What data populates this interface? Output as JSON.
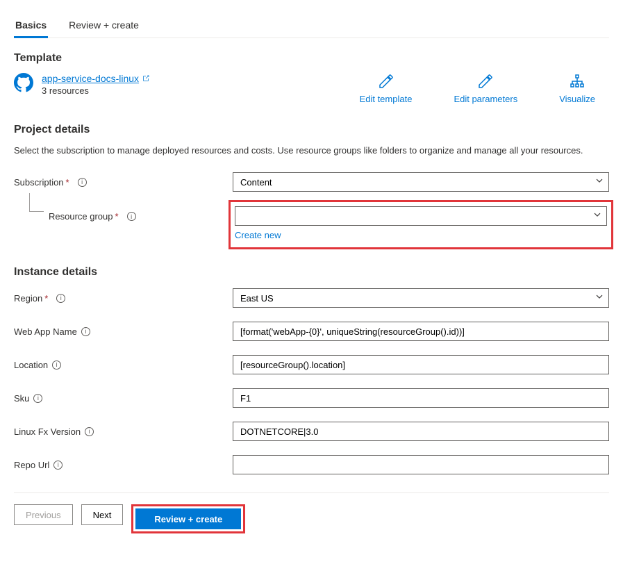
{
  "tabs": {
    "basics": "Basics",
    "review": "Review + create"
  },
  "template": {
    "heading": "Template",
    "name": "app-service-docs-linux",
    "resources": "3 resources",
    "actions": {
      "edit_template": "Edit template",
      "edit_parameters": "Edit parameters",
      "visualize": "Visualize"
    }
  },
  "project": {
    "heading": "Project details",
    "desc": "Select the subscription to manage deployed resources and costs. Use resource groups like folders to organize and manage all your resources.",
    "subscription_label": "Subscription",
    "subscription_value": "Content",
    "resource_group_label": "Resource group",
    "resource_group_value": "",
    "create_new": "Create new"
  },
  "instance": {
    "heading": "Instance details",
    "region_label": "Region",
    "region_value": "East US",
    "webapp_label": "Web App Name",
    "webapp_value": "[format('webApp-{0}', uniqueString(resourceGroup().id))]",
    "location_label": "Location",
    "location_value": "[resourceGroup().location]",
    "sku_label": "Sku",
    "sku_value": "F1",
    "linuxfx_label": "Linux Fx Version",
    "linuxfx_value": "DOTNETCORE|3.0",
    "repo_label": "Repo Url",
    "repo_value": ""
  },
  "footer": {
    "previous": "Previous",
    "next": "Next",
    "review": "Review + create"
  }
}
